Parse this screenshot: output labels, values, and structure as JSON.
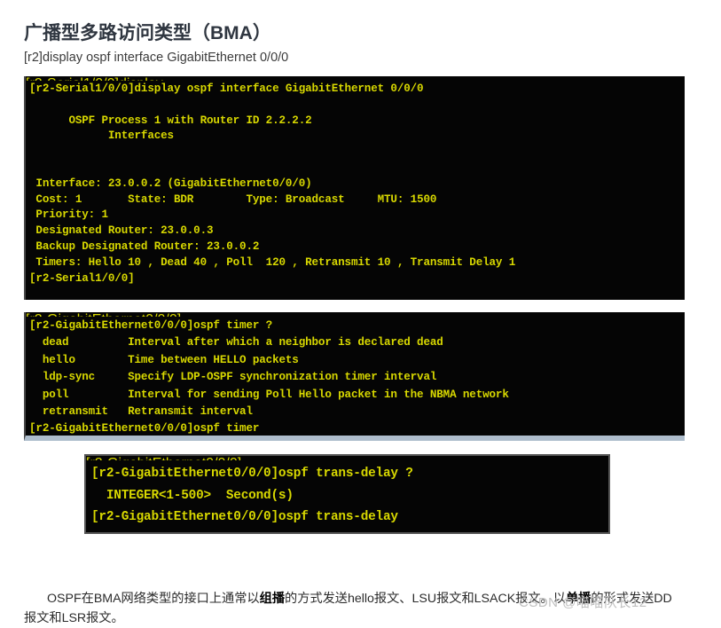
{
  "page": {
    "title": "广播型多路访问类型（BMA）",
    "subtitle": "[r2]display ospf interface GigabitEthernet 0/0/0"
  },
  "terminals": [
    {
      "name": "ospf-interface-output",
      "lines": [
        "[r2-Serial1/0/0]display ospf interface GigabitEthernet 0/0/0",
        "",
        "      OSPF Process 1 with Router ID 2.2.2.2",
        "            Interfaces",
        "",
        "",
        " Interface: 23.0.0.2 (GigabitEthernet0/0/0)",
        " Cost: 1       State: BDR        Type: Broadcast     MTU: 1500",
        " Priority: 1",
        " Designated Router: 23.0.0.3",
        " Backup Designated Router: 23.0.0.2",
        " Timers: Hello 10 , Dead 40 , Poll  120 , Retransmit 10 , Transmit Delay 1",
        "[r2-Serial1/0/0]"
      ]
    },
    {
      "name": "ospf-timer-help-output",
      "lines": [
        "[r2-GigabitEthernet0/0/0]ospf timer ?",
        "  dead         Interval after which a neighbor is declared dead",
        "  hello        Time between HELLO packets",
        "  ldp-sync     Specify LDP-OSPF synchronization timer interval",
        "  poll         Interval for sending Poll Hello packet in the NBMA network",
        "  retransmit   Retransmit interval",
        "[r2-GigabitEthernet0/0/0]ospf timer"
      ]
    },
    {
      "name": "ospf-trans-delay-help-output",
      "lines": [
        "[r2-GigabitEthernet0/0/0]ospf trans-delay ?",
        "  INTEGER<1-500>  Second(s)",
        "[r2-GigabitEthernet0/0/0]ospf trans-delay"
      ]
    }
  ],
  "paragraph": {
    "part1": "OSPF在BMA网络类型的接口上通常以",
    "bold1": "组播",
    "part2": "的方式发送hello报文、LSU报文和LSACK报文。以",
    "bold2": "单播",
    "part3": "的形式发送DD报文和LSR报文。"
  },
  "watermark": {
    "text": "CSDN @喵喵队长12"
  },
  "colors": {
    "terminal_bg": "#050505",
    "terminal_text": "#d8d800",
    "title": "#2f3640",
    "scroll_strip": "#aebdcc"
  }
}
